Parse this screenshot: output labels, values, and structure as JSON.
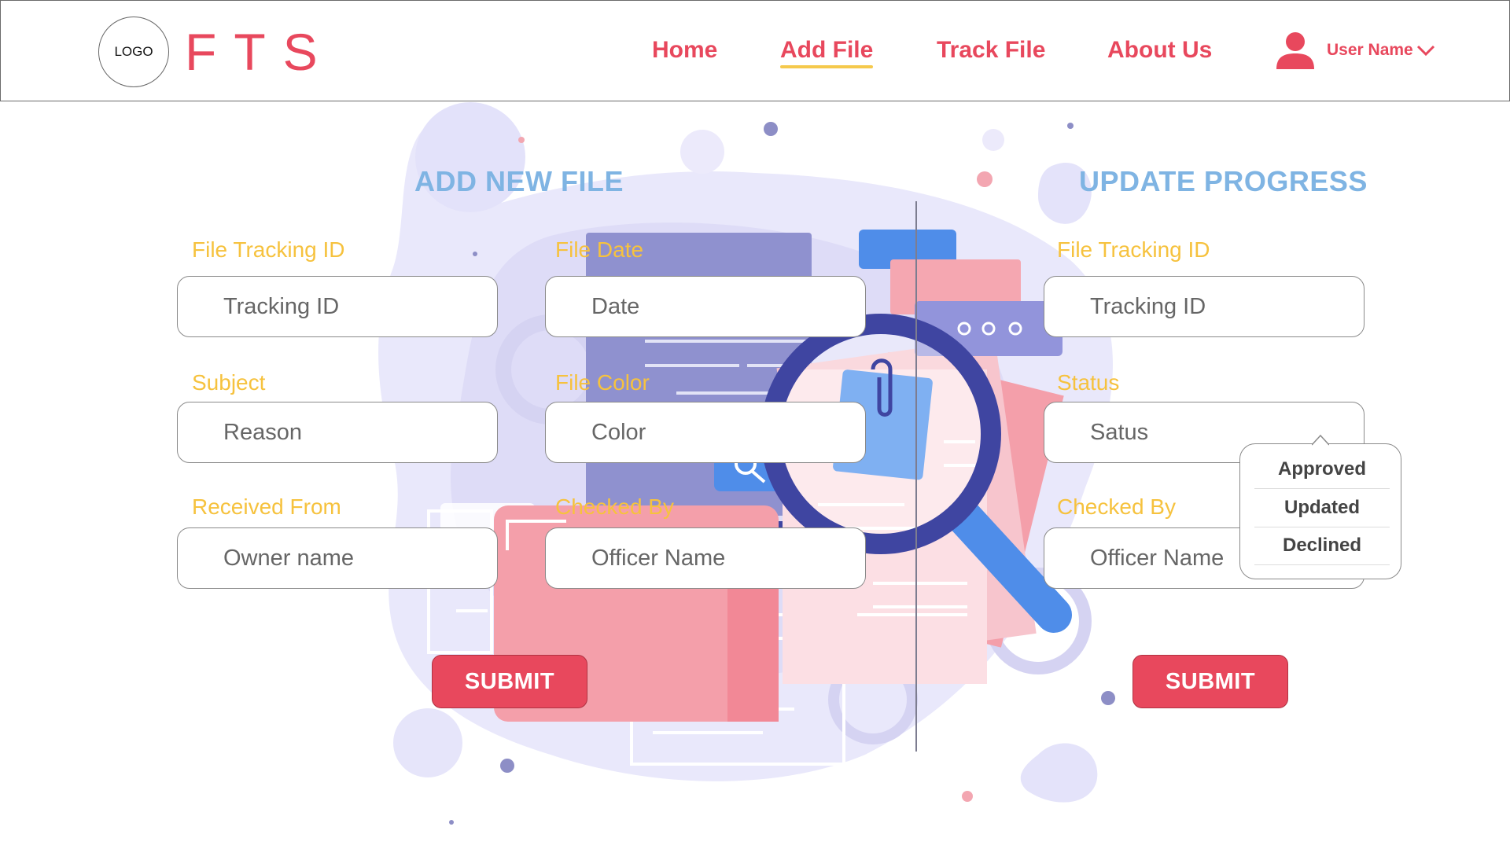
{
  "header": {
    "logo_text": "LOGO",
    "brand": "FTS",
    "nav": [
      "Home",
      "Add File",
      "Track File",
      "About Us"
    ],
    "active_nav": "Add File",
    "user_name": "User Name"
  },
  "add_file": {
    "title": "ADD NEW FILE",
    "tracking_label": "File Tracking ID",
    "tracking_placeholder": "Tracking ID",
    "date_label": "File Date",
    "date_placeholder": "Date",
    "subject_label": "Subject",
    "subject_placeholder": "Reason",
    "color_label": "File Color",
    "color_placeholder": "Color",
    "received_label": "Received From",
    "received_placeholder": "Owner name",
    "checked_label": "Checked By",
    "checked_placeholder": "Officer Name",
    "submit": "SUBMIT"
  },
  "update_progress": {
    "title": "UPDATE PROGRESS",
    "tracking_label": "File Tracking ID",
    "tracking_placeholder": "Tracking ID",
    "status_label": "Status",
    "status_placeholder": "Satus",
    "status_options": [
      "Approved",
      "Updated",
      "Declined"
    ],
    "checked_label": "Checked By",
    "checked_placeholder": "Officer Name",
    "submit": "SUBMIT"
  },
  "colors": {
    "accent": "#e8485d",
    "label": "#f6c23e",
    "title": "#7fb4e3",
    "underline": "#f5c94c"
  },
  "icons": [
    "user-icon",
    "chevron-down-icon",
    "magnifier-illustration"
  ]
}
